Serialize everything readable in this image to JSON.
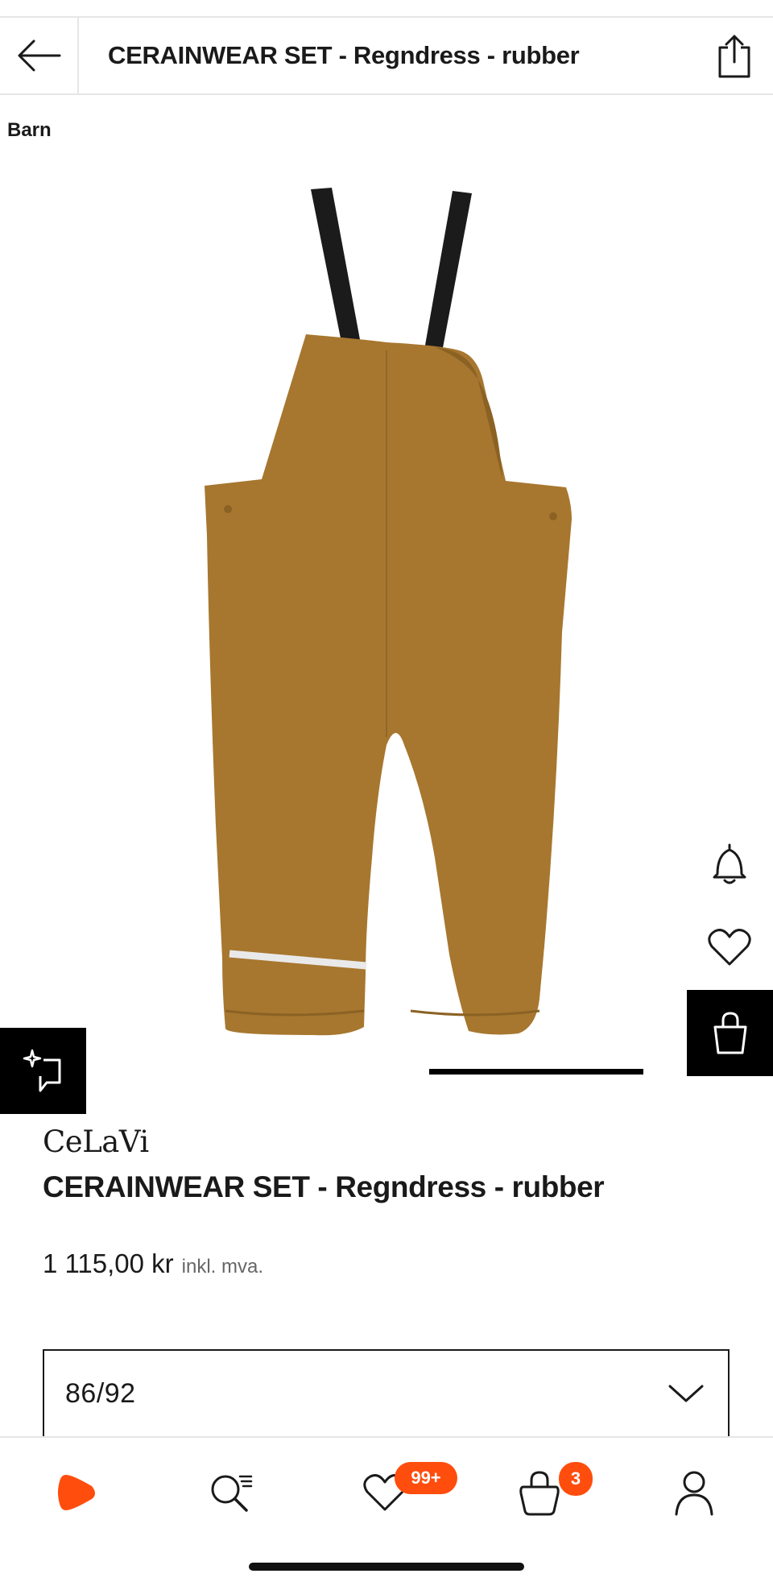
{
  "header": {
    "back_icon": "arrow-left-icon",
    "title": "CERAINWEAR SET - Regndress - rubber",
    "share_icon": "share-icon"
  },
  "category": "Barn",
  "product": {
    "brand": "CeLaVi",
    "name": "CERAINWEAR SET - Regndress - rubber",
    "price": "1 115,00 kr",
    "vat_note": "inkl. mva.",
    "image_colors": {
      "fabric": "#a7772f",
      "fabric_shadow": "#8b6224",
      "strap": "#1b1b1b",
      "reflector": "#e9e9e9"
    },
    "size_selected": "86/92"
  },
  "actions": {
    "notify_icon": "bell-icon",
    "wishlist_icon": "heart-icon",
    "add_to_bag_icon": "shopping-bag-icon",
    "similar_icon": "sparkle-similar-icon"
  },
  "bottom_nav": {
    "items": [
      {
        "name": "home",
        "icon": "zalando-logo-icon"
      },
      {
        "name": "search",
        "icon": "search-icon"
      },
      {
        "name": "wishlist",
        "icon": "heart-icon",
        "badge": "99+"
      },
      {
        "name": "bag",
        "icon": "bag-icon",
        "badge": "3"
      },
      {
        "name": "profile",
        "icon": "user-icon"
      }
    ]
  },
  "colors": {
    "accent": "#ff4d0d",
    "border": "#e6e6e6"
  }
}
